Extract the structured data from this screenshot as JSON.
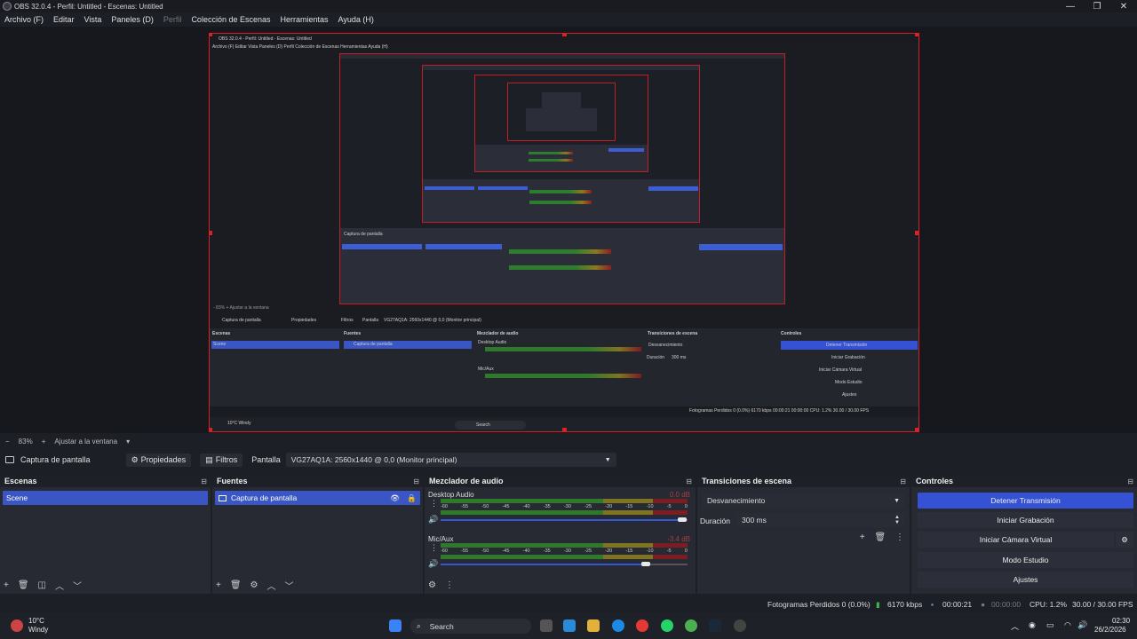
{
  "window": {
    "title": "OBS 32.0.4 - Perfil: Untitled - Escenas: Untitled",
    "controls": {
      "minimize": "—",
      "maximize": "❐",
      "close": "✕"
    }
  },
  "menu": [
    "Archivo (F)",
    "Editar",
    "Vista",
    "Paneles (D)",
    "Perfil",
    "Colección de Escenas",
    "Herramientas",
    "Ayuda (H)"
  ],
  "preview": {
    "nested_title": "OBS 32.0.4 - Perfil: Untitled - Escenas: Untitled",
    "nested_menu": "Archivo (F)   Editar   Vista   Paneles (D)   Perfil   Colección de Escenas   Herramientas   Ayuda (H)",
    "nested_source_label": "Captura de pantalla",
    "nested_props": "Propiedades",
    "nested_filters": "Filtros",
    "nested_display": "Pantalla",
    "nested_monitor": "VG27AQ1A: 2560x1440 @ 0,0 (Monitor principal)",
    "nested_zoom": "- 83% + Ajustar a la ventana",
    "nested_docks": {
      "scenes": "Escenas",
      "sources": "Fuentes",
      "mixer": "Mezclador de audio",
      "transitions": "Transiciones de escena",
      "controls": "Controles"
    },
    "nested_scene": "Scene",
    "nested_source": "Captura de pantalla",
    "nested_desktop": "Desktop Audio",
    "nested_mic": "Mic/Aux",
    "nested_transition": "Desvanecimiento",
    "nested_duration": "Duración",
    "nested_duration_val": "300 ms",
    "nested_ctl": [
      "Detener Transmisión",
      "Iniciar Grabación",
      "Iniciar Cámara Virtual",
      "Modo Estudio",
      "Ajustes"
    ],
    "nested_status": "Fotogramas Perdidos 0 (0.0%)   6170 kbps   00:00:21   00:00:00   CPU: 1.2%   30.00 / 30.00 FPS",
    "nested_search": "Search",
    "nested_weather": "10°C Windy"
  },
  "zoombar": {
    "minus": "−",
    "zoom": "83%",
    "plus": "+",
    "fit": "Ajustar a la ventana",
    "arrow": "▾"
  },
  "sourcebar": {
    "source_name": "Captura de pantalla",
    "properties": "Propiedades",
    "filters": "Filtros",
    "display_label": "Pantalla",
    "display_value": "VG27AQ1A: 2560x1440 @ 0,0 (Monitor principal)"
  },
  "scenes": {
    "title": "Escenas",
    "items": [
      "Scene"
    ]
  },
  "sources": {
    "title": "Fuentes",
    "items": [
      "Captura de pantalla"
    ]
  },
  "mixer": {
    "title": "Mezclador de audio",
    "ticks": [
      "-60",
      "-55",
      "-50",
      "-45",
      "-40",
      "-35",
      "-30",
      "-25",
      "-20",
      "-15",
      "-10",
      "-5",
      "0"
    ],
    "channels": [
      {
        "name": "Desktop Audio",
        "db": "0.0 dB",
        "volume": 0.98
      },
      {
        "name": "Mic/Aux",
        "db": "-3.4 dB",
        "volume": 0.83
      }
    ]
  },
  "transitions": {
    "title": "Transiciones de escena",
    "selected": "Desvanecimiento",
    "duration_label": "Duración",
    "duration_value": "300 ms"
  },
  "controls": {
    "title": "Controles",
    "buttons": [
      "Detener Transmisión",
      "Iniciar Grabación",
      "Iniciar Cámara Virtual",
      "Modo Estudio",
      "Ajustes"
    ]
  },
  "status": {
    "dropped": "Fotogramas Perdidos 0 (0.0%)",
    "bitrate": "6170 kbps",
    "stream_time": "00:00:21",
    "rec_time": "00:00:00",
    "cpu": "CPU: 1.2%",
    "fps": "30.00 / 30.00 FPS"
  },
  "taskbar": {
    "weather_temp": "10°C",
    "weather_desc": "Windy",
    "search": "Search",
    "time": "02:30",
    "date": "26/2/2026"
  },
  "colors": {
    "accent": "#3452d3",
    "selection_red": "#d4202a",
    "meter_green": "#2f7a2a",
    "meter_yellow": "#7f7420",
    "meter_red": "#7b1d22"
  }
}
